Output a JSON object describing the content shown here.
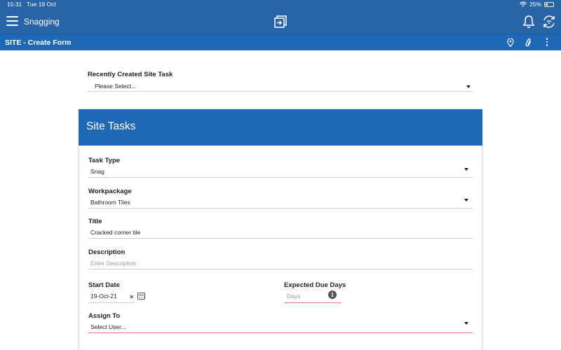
{
  "status_bar": {
    "time": "15:31",
    "date": "Tue 19 Oct",
    "battery": "25%"
  },
  "app_bar": {
    "title": "Snagging",
    "icons": [
      "menu-icon",
      "app-logo-icon",
      "bell-icon",
      "sync-icon"
    ]
  },
  "sub_bar": {
    "title": "SITE - Create Form",
    "icons": [
      "location-pin-icon",
      "paperclip-icon",
      "more-vert-icon"
    ]
  },
  "recent_task": {
    "label": "Recently Created Site Task",
    "value": "Please Select..."
  },
  "card": {
    "title": "Site Tasks"
  },
  "fields": {
    "task_type": {
      "label": "Task Type",
      "value": "Snag"
    },
    "workpackage": {
      "label": "Workpackage",
      "value": "Bathroom Tiles"
    },
    "title": {
      "label": "Title",
      "value": "Cracked corner tile"
    },
    "description": {
      "label": "Description",
      "placeholder": "Enter Description"
    },
    "start_date": {
      "label": "Start Date",
      "value": "19-Oct-21",
      "clear": "×"
    },
    "expected_due_days": {
      "label": "Expected Due Days",
      "placeholder": "Days",
      "info": "i"
    },
    "assign_to": {
      "label": "Assign To",
      "value": "Select User..."
    }
  },
  "colors": {
    "header_blue": "#2a64a8",
    "sub_blue": "#1e69b6",
    "error_red": "#e07a7a"
  }
}
